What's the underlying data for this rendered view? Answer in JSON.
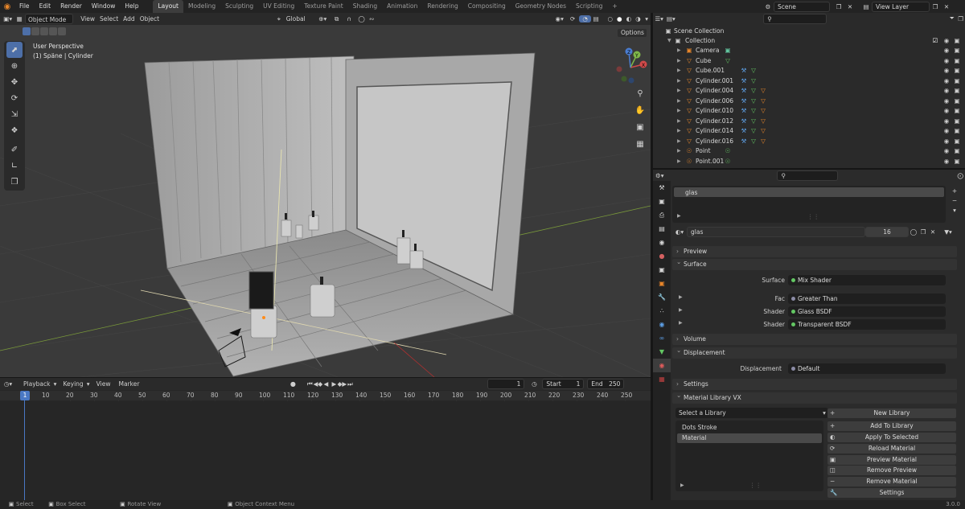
{
  "topbar": {
    "menus": [
      "File",
      "Edit",
      "Render",
      "Window",
      "Help"
    ],
    "workspaces": [
      "Layout",
      "Modeling",
      "Sculpting",
      "UV Editing",
      "Texture Paint",
      "Shading",
      "Animation",
      "Rendering",
      "Compositing",
      "Geometry Nodes",
      "Scripting"
    ],
    "active_workspace": "Layout",
    "add_tab": "+",
    "scene": "Scene",
    "view_layer": "View Layer"
  },
  "viewport": {
    "mode": "Object Mode",
    "menus": [
      "View",
      "Select",
      "Add",
      "Object"
    ],
    "orientation": "Global",
    "options_label": "Options",
    "overlay_title": "User Perspective",
    "overlay_subtitle": "(1) Späne | Cylinder",
    "gizmo_axes": [
      "X",
      "Y",
      "Z"
    ]
  },
  "timeline": {
    "menus": [
      "Playback",
      "Keying",
      "View",
      "Marker"
    ],
    "current_frame": "1",
    "start_label": "Start",
    "start": "1",
    "end_label": "End",
    "end": "250",
    "ruler": [
      "1",
      "10",
      "20",
      "30",
      "40",
      "50",
      "60",
      "70",
      "80",
      "90",
      "100",
      "110",
      "120",
      "130",
      "140",
      "150",
      "160",
      "170",
      "180",
      "190",
      "200",
      "210",
      "220",
      "230",
      "240",
      "250"
    ]
  },
  "status": {
    "items": [
      "Select",
      "Box Select",
      "Rotate View",
      "Object Context Menu"
    ],
    "version": "3.0.0"
  },
  "outliner": {
    "root": "Scene Collection",
    "collection": "Collection",
    "items": [
      {
        "name": "Camera",
        "type": "camera"
      },
      {
        "name": "Cube",
        "type": "mesh"
      },
      {
        "name": "Cube.001",
        "type": "mesh"
      },
      {
        "name": "Cylinder.001",
        "type": "mesh"
      },
      {
        "name": "Cylinder.004",
        "type": "mesh"
      },
      {
        "name": "Cylinder.006",
        "type": "mesh"
      },
      {
        "name": "Cylinder.010",
        "type": "mesh"
      },
      {
        "name": "Cylinder.012",
        "type": "mesh"
      },
      {
        "name": "Cylinder.014",
        "type": "mesh"
      },
      {
        "name": "Cylinder.016",
        "type": "mesh"
      },
      {
        "name": "Point",
        "type": "light"
      },
      {
        "name": "Point.001",
        "type": "light"
      }
    ]
  },
  "properties": {
    "slot": "glas",
    "material_name": "glas",
    "users": "16",
    "panels": {
      "preview": "Preview",
      "surface": "Surface",
      "volume": "Volume",
      "displacement": "Displacement",
      "settings": "Settings",
      "library": "Material Library VX"
    },
    "surface_rows": [
      {
        "label": "Surface",
        "value": "Mix Shader"
      },
      {
        "label": "Fac",
        "value": "Greater Than"
      },
      {
        "label": "Shader",
        "value": "Glass BSDF"
      },
      {
        "label": "Shader",
        "value": "Transparent BSDF"
      }
    ],
    "displacement_row": {
      "label": "Displacement",
      "value": "Default"
    },
    "library": {
      "select_placeholder": "Select a Library",
      "items": [
        "Dots Stroke",
        "Material"
      ],
      "buttons": [
        "New Library",
        "Add To Library",
        "Apply To Selected",
        "Reload Material",
        "Preview Material",
        "Remove Preview",
        "Remove Material",
        "Settings"
      ]
    }
  }
}
